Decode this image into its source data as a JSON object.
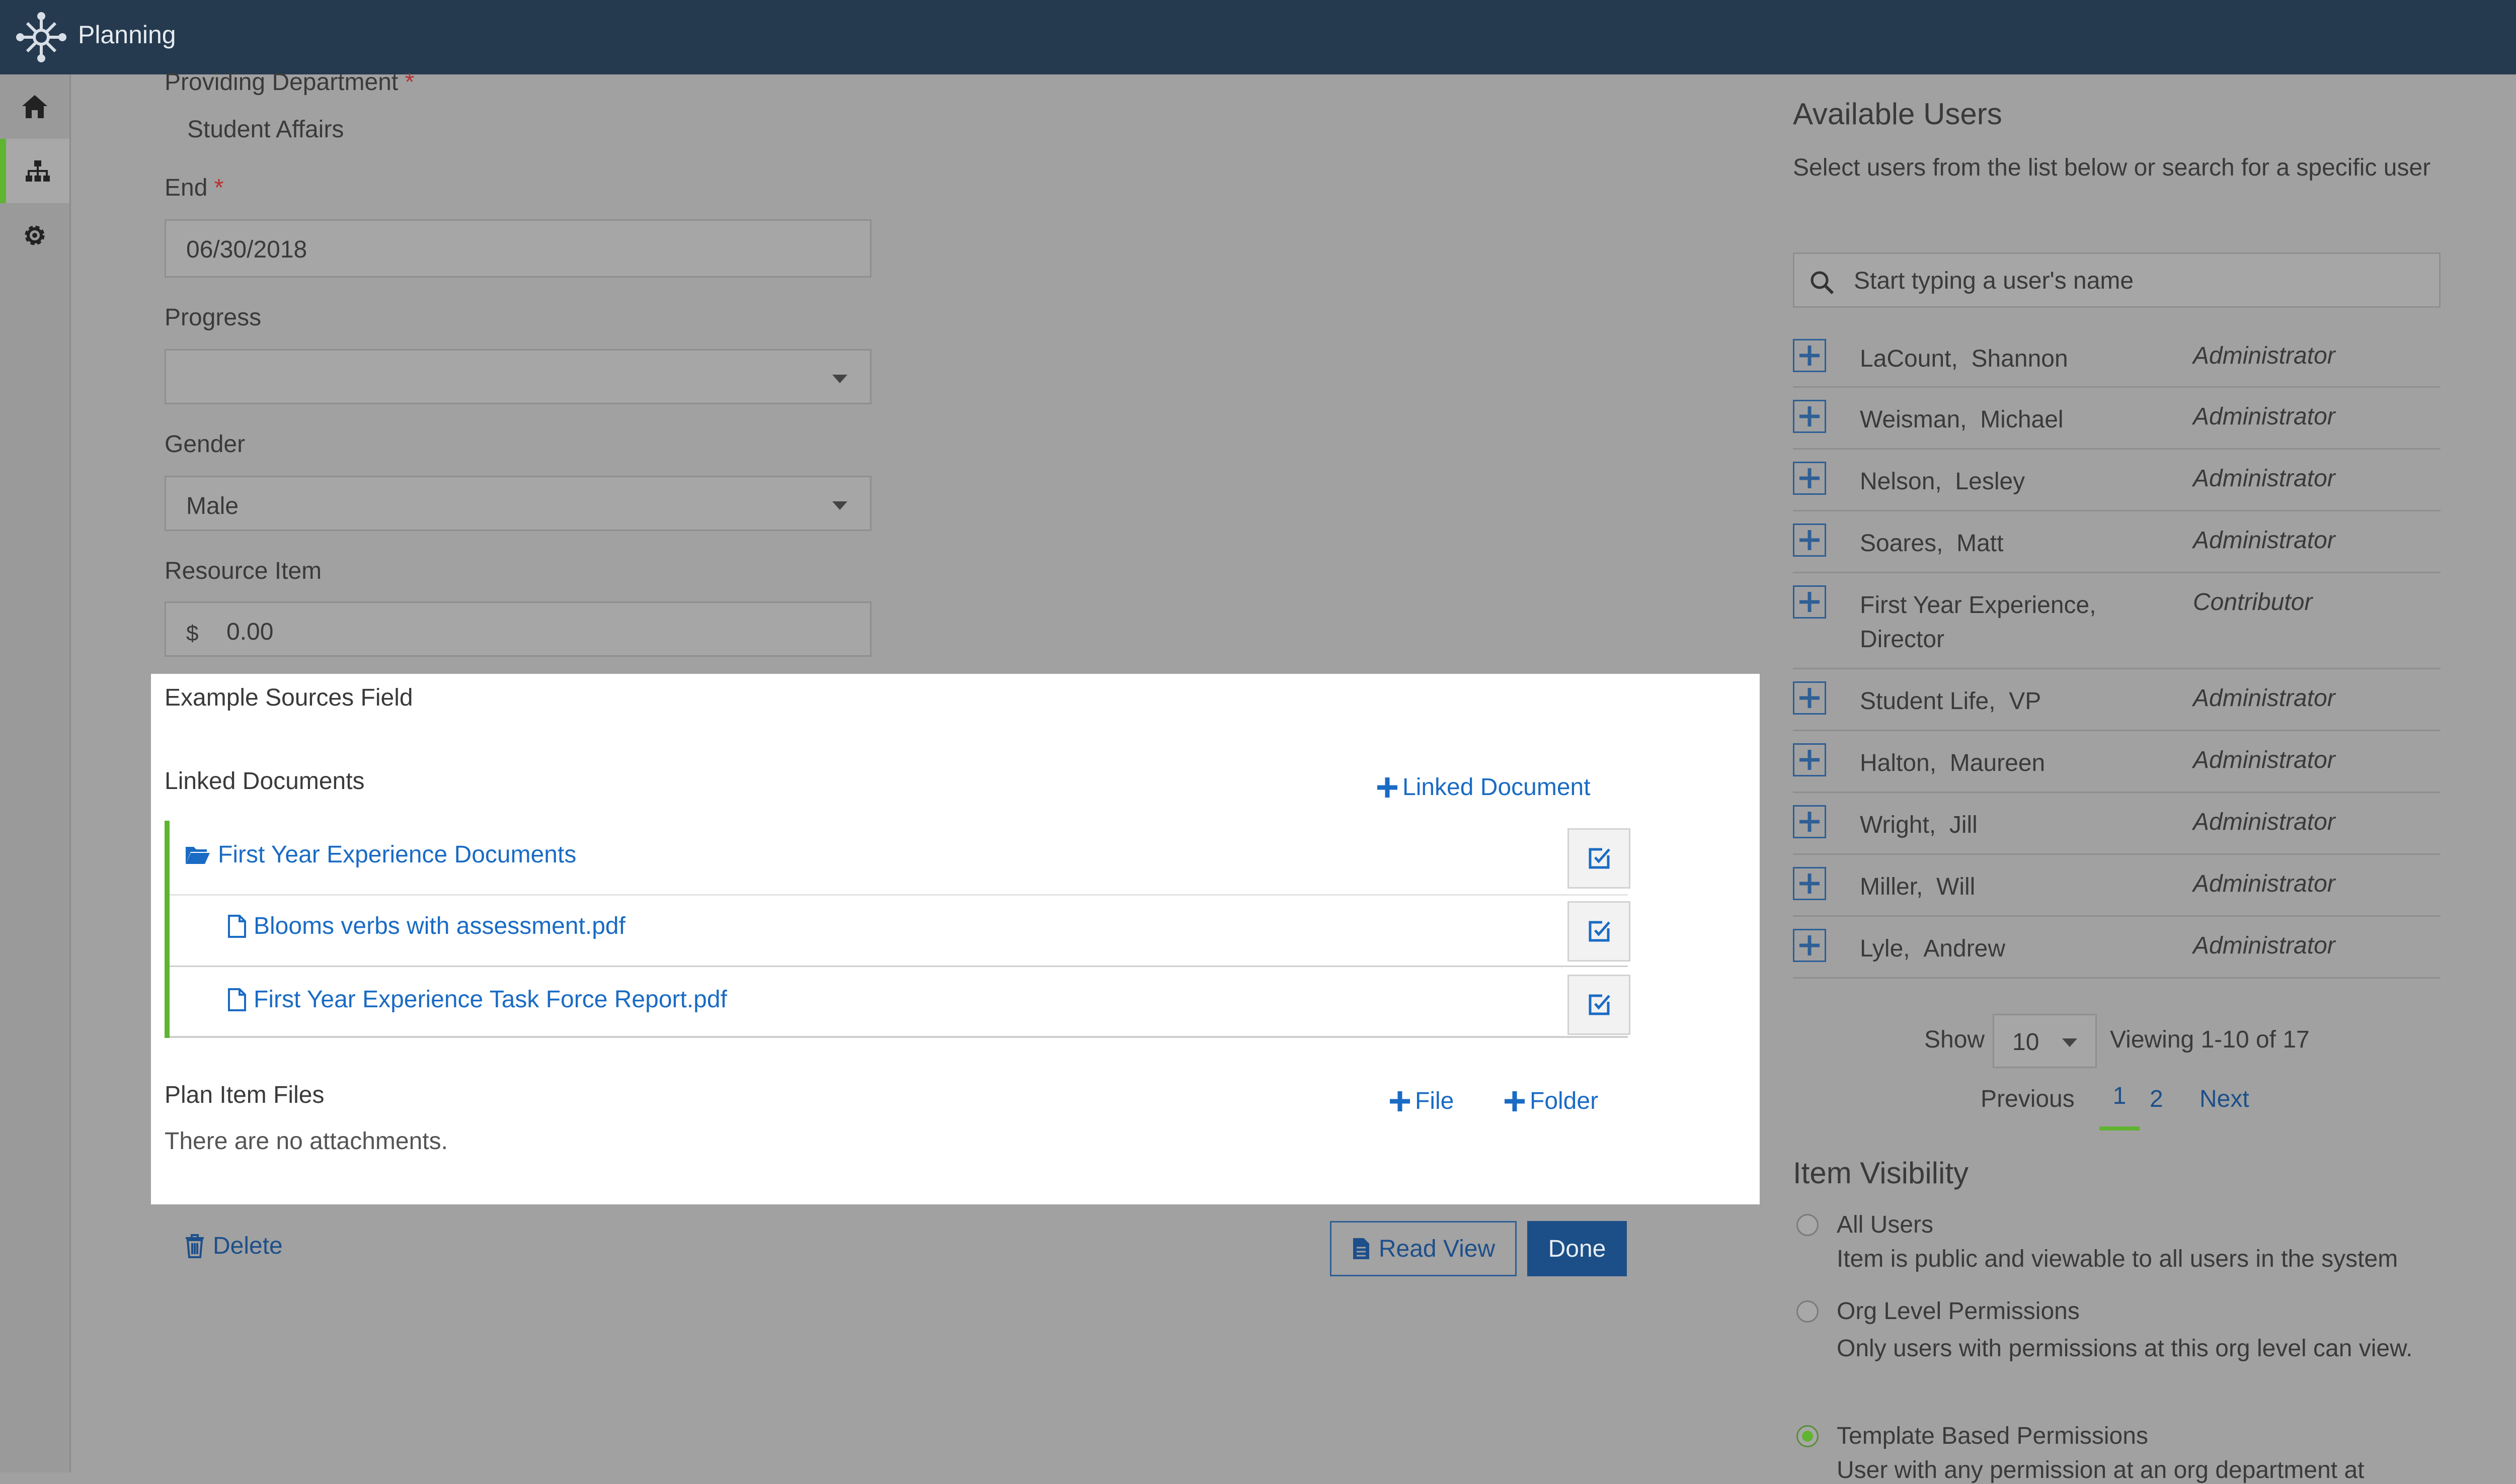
{
  "app": {
    "title": "Planning"
  },
  "rail": {
    "items": [
      "home-icon",
      "org-chart-icon",
      "gear-icon"
    ]
  },
  "form": {
    "providing_department": {
      "label": "Providing Department",
      "required": "*",
      "value": "Student Affairs"
    },
    "end": {
      "label": "End",
      "required": "*",
      "value": "06/30/2018"
    },
    "progress": {
      "label": "Progress",
      "value": ""
    },
    "gender": {
      "label": "Gender",
      "value": "Male"
    },
    "resource_item": {
      "label": "Resource Item",
      "prefix": "$",
      "value": "0.00"
    }
  },
  "sources": {
    "title": "Example Sources Field",
    "linked_documents_label": "Linked Documents",
    "add_linked_document": "Linked Document",
    "folder": "First Year Experience Documents",
    "files": [
      "Blooms verbs with assessment.pdf",
      "First Year Experience Task Force Report.pdf"
    ],
    "plan_item_files_label": "Plan Item Files",
    "add_file": "File",
    "add_folder": "Folder",
    "no_attachments": "There are no attachments."
  },
  "actions": {
    "delete": "Delete",
    "read_view": "Read View",
    "done": "Done"
  },
  "available_users": {
    "title": "Available Users",
    "description": "Select users from the list below or search for a specific user",
    "search_placeholder": "Start typing a user's name",
    "users": [
      {
        "last": "LaCount,",
        "first": "Shannon",
        "role": "Administrator"
      },
      {
        "last": "Weisman,",
        "first": "Michael",
        "role": "Administrator"
      },
      {
        "last": "Nelson,",
        "first": "Lesley",
        "role": "Administrator"
      },
      {
        "last": "Soares,",
        "first": "Matt",
        "role": "Administrator"
      },
      {
        "last": "First Year Experience,",
        "first": "Director",
        "role": "Contributor"
      },
      {
        "last": "Student Life,",
        "first": "VP",
        "role": "Administrator"
      },
      {
        "last": "Halton,",
        "first": "Maureen",
        "role": "Administrator"
      },
      {
        "last": "Wright,",
        "first": "Jill",
        "role": "Administrator"
      },
      {
        "last": "Miller,",
        "first": "Will",
        "role": "Administrator"
      },
      {
        "last": "Lyle,",
        "first": "Andrew",
        "role": "Administrator"
      }
    ],
    "pagination": {
      "show_label": "Show",
      "page_size": "10",
      "viewing": "Viewing 1-10 of 17",
      "previous": "Previous",
      "pages": [
        "1",
        "2"
      ],
      "next": "Next"
    }
  },
  "visibility": {
    "title": "Item Visibility",
    "options": [
      {
        "label": "All Users",
        "desc": "Item is public and viewable to all users in the system",
        "selected": false
      },
      {
        "label": "Org Level Permissions",
        "desc": "Only users with permissions at this org level can view.",
        "selected": false
      },
      {
        "label": "Template Based Permissions",
        "desc": "User with any permission at an org department at",
        "selected": true
      }
    ]
  },
  "colors": {
    "topbar": "#253a4f",
    "link": "#1a6bc4",
    "accent_green": "#5fb532",
    "primary": "#1c4f87"
  }
}
